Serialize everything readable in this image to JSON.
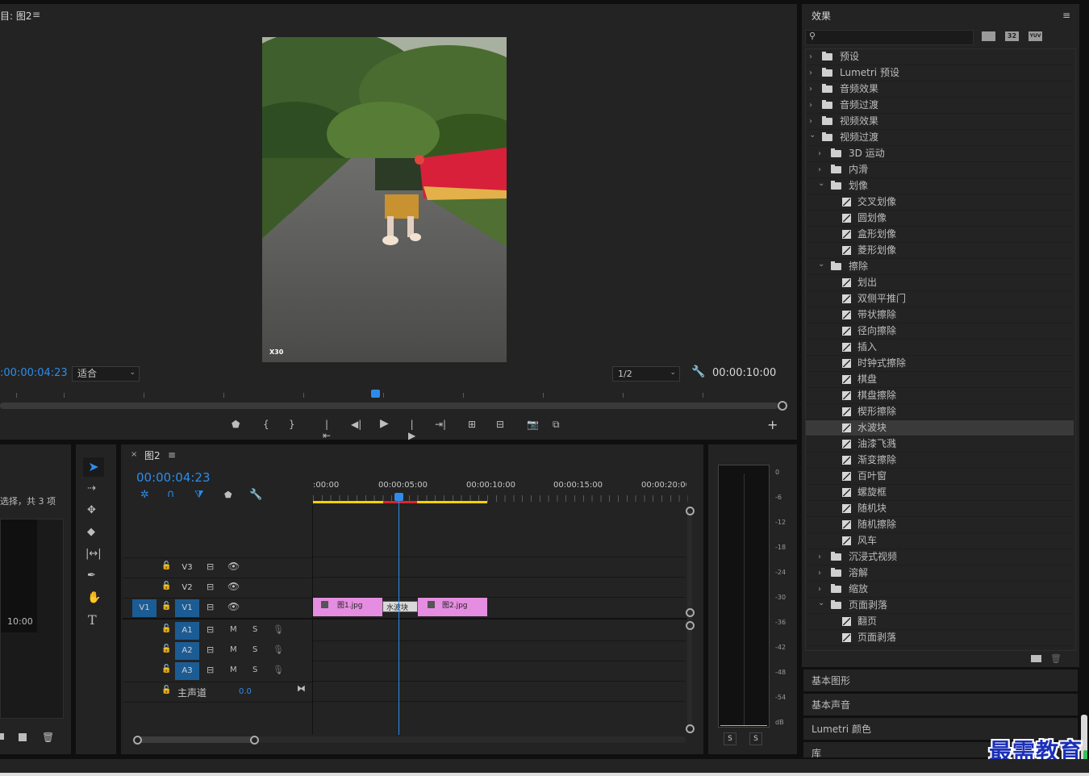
{
  "program_monitor": {
    "title": "图2",
    "title_prefix": "目: ",
    "timecode": "00:00:04:23",
    "timecode_prefix": ":",
    "zoom": "适合",
    "resolution": "1/2",
    "duration": "00:00:10:00",
    "watermark_text": "X30",
    "menu_glyph": "≡"
  },
  "project_panel": {
    "selection_text": "选择，共 3 项",
    "thumb_duration": "10:00"
  },
  "timeline": {
    "tab_title": "图2",
    "timecode": "00:00:04:23",
    "ruler_labels": [
      ":00:00",
      "00:00:05:00",
      "00:00:10:00",
      "00:00:15:00",
      "00:00:20:00"
    ],
    "video_tracks": [
      {
        "name": "V3",
        "source": ""
      },
      {
        "name": "V2",
        "source": ""
      },
      {
        "name": "V1",
        "source": "V1"
      }
    ],
    "audio_tracks": [
      {
        "name": "A1",
        "m": "M",
        "s": "S"
      },
      {
        "name": "A2",
        "m": "M",
        "s": "S"
      },
      {
        "name": "A3",
        "m": "M",
        "s": "S"
      }
    ],
    "master": {
      "label": "主声道",
      "value": "0.0"
    },
    "clips": [
      {
        "name": "图1.jpg"
      },
      {
        "name": "水波块"
      },
      {
        "name": "图2.jpg"
      }
    ]
  },
  "audio_meter": {
    "scale": [
      "0",
      "-6",
      "-12",
      "-18",
      "-24",
      "-30",
      "-36",
      "-42",
      "-48",
      "-54",
      "dB"
    ],
    "solo_left": "S",
    "solo_right": "S"
  },
  "effects": {
    "title": "效果",
    "search_placeholder": "",
    "badges": [
      "32",
      "YUV"
    ],
    "tree": [
      {
        "label": "预设",
        "level": 0,
        "type": "preset",
        "state": "closed"
      },
      {
        "label": "Lumetri 预设",
        "level": 0,
        "type": "preset",
        "state": "closed"
      },
      {
        "label": "音频效果",
        "level": 0,
        "type": "folder",
        "state": "closed"
      },
      {
        "label": "音频过渡",
        "level": 0,
        "type": "folder",
        "state": "closed"
      },
      {
        "label": "视频效果",
        "level": 0,
        "type": "folder",
        "state": "closed"
      },
      {
        "label": "视频过渡",
        "level": 0,
        "type": "folder",
        "state": "open"
      },
      {
        "label": "3D 运动",
        "level": 1,
        "type": "folder",
        "state": "closed"
      },
      {
        "label": "内滑",
        "level": 1,
        "type": "folder",
        "state": "closed"
      },
      {
        "label": "划像",
        "level": 1,
        "type": "folder",
        "state": "open"
      },
      {
        "label": "交叉划像",
        "level": 2,
        "type": "fx"
      },
      {
        "label": "圆划像",
        "level": 2,
        "type": "fx"
      },
      {
        "label": "盒形划像",
        "level": 2,
        "type": "fx"
      },
      {
        "label": "菱形划像",
        "level": 2,
        "type": "fx"
      },
      {
        "label": "擦除",
        "level": 1,
        "type": "folder",
        "state": "open"
      },
      {
        "label": "划出",
        "level": 2,
        "type": "fx"
      },
      {
        "label": "双侧平推门",
        "level": 2,
        "type": "fx"
      },
      {
        "label": "带状擦除",
        "level": 2,
        "type": "fx"
      },
      {
        "label": "径向擦除",
        "level": 2,
        "type": "fx"
      },
      {
        "label": "插入",
        "level": 2,
        "type": "fx"
      },
      {
        "label": "时钟式擦除",
        "level": 2,
        "type": "fx"
      },
      {
        "label": "棋盘",
        "level": 2,
        "type": "fx"
      },
      {
        "label": "棋盘擦除",
        "level": 2,
        "type": "fx"
      },
      {
        "label": "楔形擦除",
        "level": 2,
        "type": "fx"
      },
      {
        "label": "水波块",
        "level": 2,
        "type": "fx",
        "selected": true
      },
      {
        "label": "油漆飞溅",
        "level": 2,
        "type": "fx"
      },
      {
        "label": "渐变擦除",
        "level": 2,
        "type": "fx"
      },
      {
        "label": "百叶窗",
        "level": 2,
        "type": "fx"
      },
      {
        "label": "螺旋框",
        "level": 2,
        "type": "fx"
      },
      {
        "label": "随机块",
        "level": 2,
        "type": "fx"
      },
      {
        "label": "随机擦除",
        "level": 2,
        "type": "fx"
      },
      {
        "label": "风车",
        "level": 2,
        "type": "fx"
      },
      {
        "label": "沉浸式视频",
        "level": 1,
        "type": "folder",
        "state": "closed"
      },
      {
        "label": "溶解",
        "level": 1,
        "type": "folder",
        "state": "closed"
      },
      {
        "label": "缩放",
        "level": 1,
        "type": "folder",
        "state": "closed"
      },
      {
        "label": "页面剥落",
        "level": 1,
        "type": "folder",
        "state": "open"
      },
      {
        "label": "翻页",
        "level": 2,
        "type": "fx"
      },
      {
        "label": "页面剥落",
        "level": 2,
        "type": "fx"
      }
    ]
  },
  "side_sections": [
    "基本图形",
    "基本声音",
    "Lumetri 颜色",
    "库"
  ],
  "brand_watermark": "最需教育",
  "colors": {
    "accent": "#2d8ceb",
    "clip": "#e58de0",
    "track_on": "#1c5c94",
    "work_area": "#f5d300"
  }
}
